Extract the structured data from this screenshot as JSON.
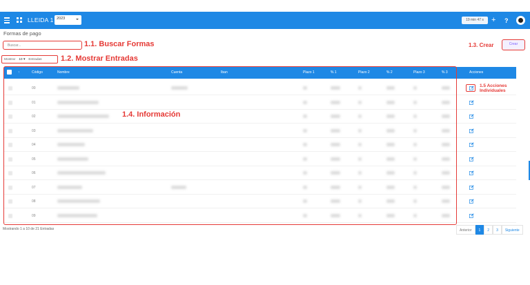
{
  "header": {
    "brand": "LLEIDA 1",
    "year": "2023",
    "timer": "19 min 47 s",
    "plus": "+",
    "help": "?"
  },
  "page": {
    "title": "Formas de pago"
  },
  "search": {
    "placeholder": "Buscar..."
  },
  "entries": {
    "show_label": "Mostrar",
    "value": "10",
    "entries_label": "Entradas"
  },
  "create_label": "Crear",
  "annotations": {
    "search": "1.1. Buscar Formas",
    "show_entries": "1.2. Mostrar Entradas",
    "create": "1.3. Crear",
    "info": "1.4. Información",
    "actions_1": "1.5 Acciones",
    "actions_2": "Individuales"
  },
  "table": {
    "columns": [
      "Código",
      "Nombre",
      "Cuenta",
      "Iban",
      "Plazo 1",
      "% 1",
      "Plazo 2",
      "% 2",
      "Plazo 3",
      "% 3",
      "Acciones"
    ],
    "sort_indicator": "↑",
    "rows": [
      {
        "code": "00"
      },
      {
        "code": "01"
      },
      {
        "code": "02"
      },
      {
        "code": "03"
      },
      {
        "code": "04"
      },
      {
        "code": "05"
      },
      {
        "code": "06"
      },
      {
        "code": "07"
      },
      {
        "code": "08"
      },
      {
        "code": "09"
      }
    ]
  },
  "footer": {
    "info": "Mostrando 1 a 10 de 21 Entradas"
  },
  "pagination": {
    "prev": "Anterior",
    "pages": [
      "1",
      "2",
      "3"
    ],
    "next": "Siguiente",
    "active": "1"
  },
  "colors": {
    "primary": "#1e88e5",
    "annotation": "#e53935",
    "create_text": "#7b61ff"
  }
}
